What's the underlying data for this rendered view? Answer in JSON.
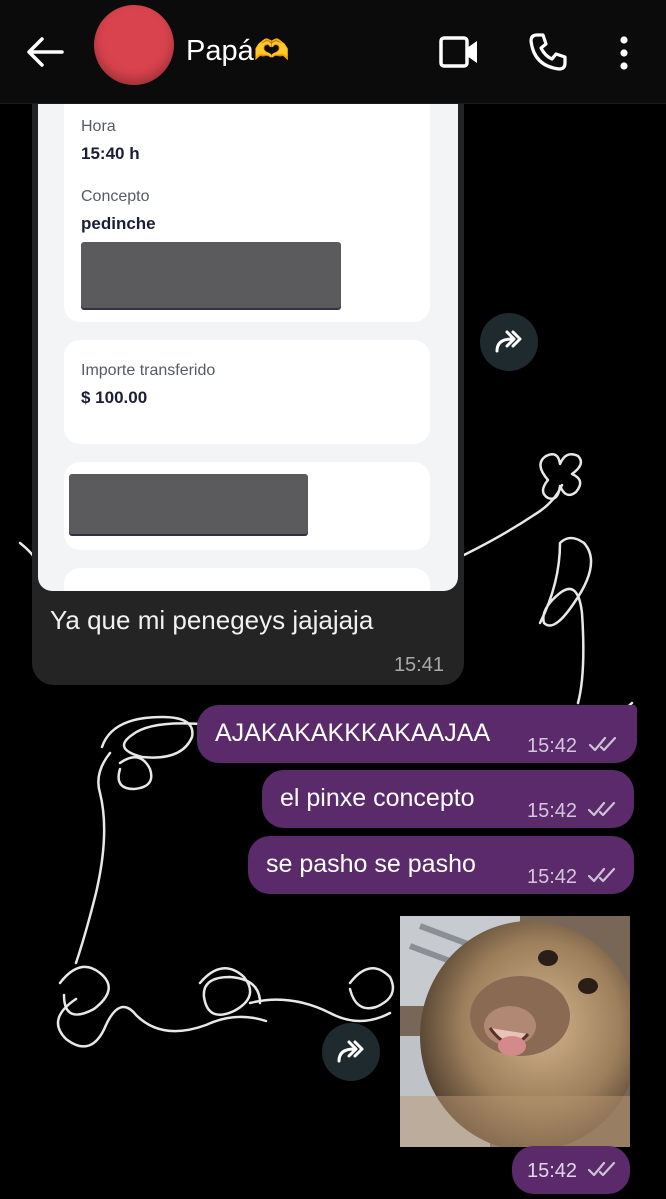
{
  "header": {
    "contact_name": "Papá🫶",
    "avatar_color": "#d9434d",
    "icons": [
      "back-arrow-icon",
      "video-call-icon",
      "phone-icon",
      "more-vert-icon"
    ]
  },
  "screenshot_card": {
    "hora_label": "Hora",
    "hora_value": "15:40 h",
    "concepto_label": "Concepto",
    "concepto_value": "pedinche",
    "importe_label": "Importe transferido",
    "importe_value": "$ 100.00"
  },
  "messages": {
    "incoming_text": "Ya que mi penegeys jajajaja",
    "incoming_time": "15:41",
    "out1_text": "AJAKAKAKKKAKAAJAA",
    "out1_time": "15:42",
    "out2_text": "el pinxe concepto",
    "out2_time": "15:42",
    "out3_text": "se pasho se pasho",
    "out3_time": "15:42",
    "media_time": "15:42"
  },
  "colors": {
    "outgoing_bubble": "#5a2a6a",
    "incoming_bubble": "#242424",
    "background": "#000000"
  }
}
